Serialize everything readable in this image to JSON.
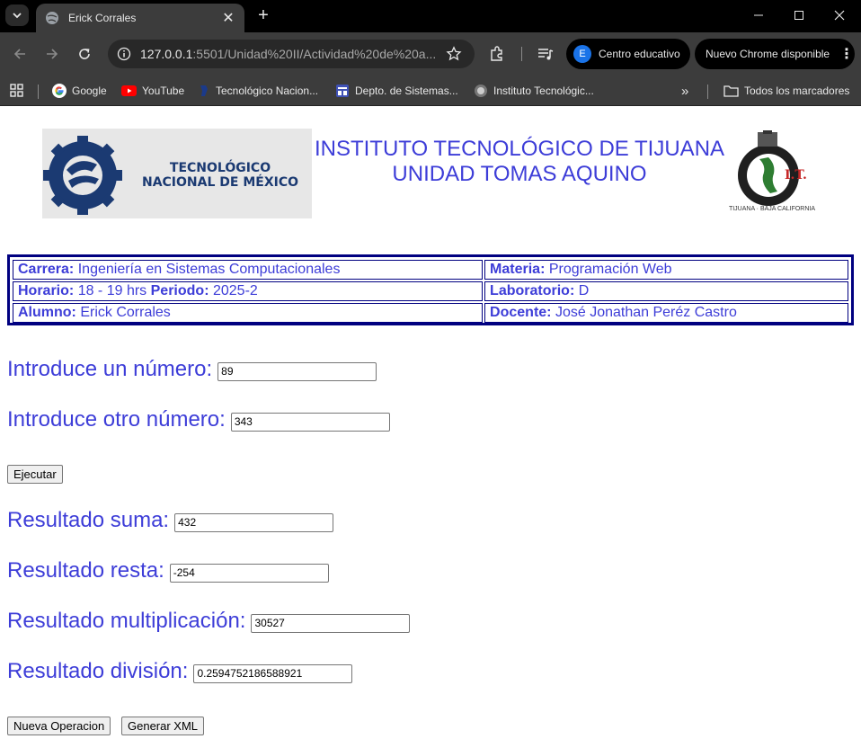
{
  "browser": {
    "tab_title": "Erick Corrales",
    "url_host": "127.0.0.1",
    "url_rest": ":5501/Unidad%20II/Actividad%20de%20a...",
    "profile_initial": "E",
    "profile_label": "Centro educativo",
    "update_label": "Nuevo Chrome disponible",
    "bookmarks": [
      "Google",
      "YouTube",
      "Tecnológico Nacion...",
      "Depto. de Sistemas...",
      "Instituto Tecnológic..."
    ],
    "all_bookmarks": "Todos los marcadores"
  },
  "header": {
    "logo_line1": "TECNOLÓGICO",
    "logo_line2": "NACIONAL DE MÉXICO",
    "title_line1": "INSTITUTO TECNOLÓGICO DE TIJUANA",
    "title_line2": "UNIDAD TOMAS AQUINO",
    "seal_text": "TIJUANA · BAJA CALIFORNIA",
    "seal_mark": "I.T."
  },
  "info": {
    "carrera_label": "Carrera:",
    "carrera": "Ingeniería en Sistemas Computacionales",
    "materia_label": "Materia:",
    "materia": "Programación Web",
    "horario_label": "Horario:",
    "horario": "18 - 19 hrs",
    "periodo_label": "Periodo:",
    "periodo": "2025-2",
    "laboratorio_label": "Laboratorio:",
    "laboratorio": "D",
    "alumno_label": "Alumno:",
    "alumno": "Erick Corrales",
    "docente_label": "Docente:",
    "docente": "José Jonathan Peréz Castro"
  },
  "form": {
    "num1_label": "Introduce un número:",
    "num1_value": "89",
    "num2_label": "Introduce otro número:",
    "num2_value": "343",
    "ejecutar_label": "Ejecutar",
    "suma_label": "Resultado suma:",
    "suma_value": "432",
    "resta_label": "Resultado resta:",
    "resta_value": "-254",
    "mult_label": "Resultado multiplicación:",
    "mult_value": "30527",
    "div_label": "Resultado división:",
    "div_value": "0.2594752186588921",
    "nueva_label": "Nueva Operacion",
    "xml_label": "Generar XML"
  },
  "colors": {
    "accent_text": "#3d3dd8",
    "table_border": "#000080"
  }
}
